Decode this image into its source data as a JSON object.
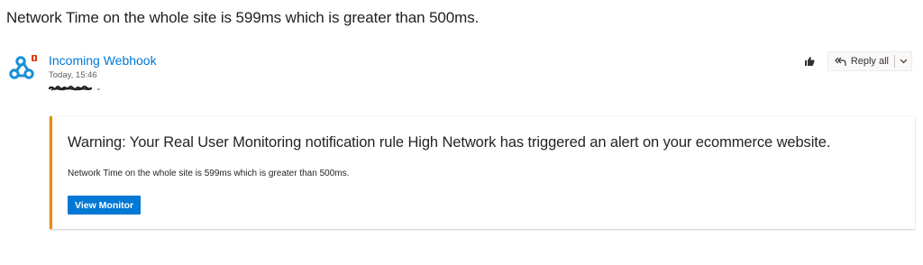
{
  "email": {
    "subject": "Network Time on the whole site is 599ms which is greater than 500ms.",
    "sender": {
      "name": "Incoming Webhook",
      "time": "Today, 15:46",
      "icon": "webhook-icon"
    },
    "recipient_icon": "chevron-down-icon"
  },
  "actions": {
    "like_icon": "thumbs-up-icon",
    "reply_all_label": "Reply all",
    "reply_all_icon": "reply-all-icon",
    "more_icon": "chevron-down-icon"
  },
  "card": {
    "accent_color": "#e88b0e",
    "title": "Warning: Your Real User Monitoring notification rule High Network has triggered an alert on your ecommerce website.",
    "body": "Network Time on the whole site is 599ms which is greater than 500ms.",
    "button_label": "View Monitor",
    "button_color": "#0078d4"
  }
}
